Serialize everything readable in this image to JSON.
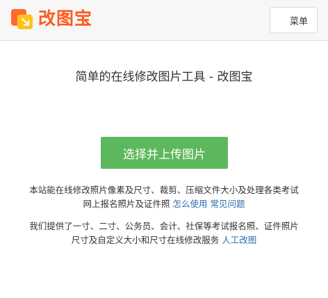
{
  "header": {
    "logo_text": "改图宝",
    "menu_label": "菜单"
  },
  "main": {
    "title": "简单的在线修改图片工具 - 改图宝",
    "upload_label": "选择并上传图片",
    "para1_line1": "本站能在线修改照片像素及尺寸、裁剪、压缩文件大小及处理各类考试",
    "para1_line2": "网上报名照片及证件照",
    "link_howto": "怎么使用",
    "link_faq": "常见问题",
    "para2_line1": "我们提供了一寸、二寸、公务员、会计、社保等考试报名照、证件照片",
    "para2_line2": "尺寸及自定义大小和尺寸在线修改服务",
    "link_manual": "人工改图"
  },
  "colors": {
    "brand": "#ff5a1f",
    "button": "#5cb85c",
    "link": "#2a6fb0"
  }
}
